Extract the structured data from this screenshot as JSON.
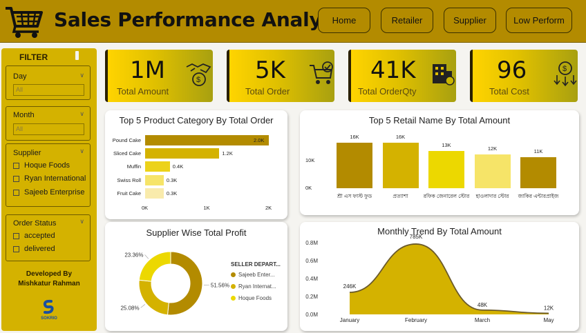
{
  "header": {
    "title": "Sales Performance Analysis",
    "nav": [
      "Home",
      "Retailer",
      "Supplier",
      "Low Perform"
    ]
  },
  "filter": {
    "title": "FILTER",
    "day": {
      "label": "Day",
      "value": "All"
    },
    "month": {
      "label": "Month",
      "value": "All"
    },
    "supplier": {
      "label": "Supplier",
      "options": [
        "Hoque Foods",
        "Ryan International",
        "Sajeeb Enterprise"
      ]
    },
    "order_status": {
      "label": "Order Status",
      "options": [
        "accepted",
        "delivered"
      ]
    },
    "developed_by": "Developed By",
    "developer": "Mishkatur Rahman",
    "brand": "SOKRIO"
  },
  "kpis": [
    {
      "value": "1M",
      "label": "Total Amount",
      "icon": "handshake-money-icon"
    },
    {
      "value": "5K",
      "label": "Total Order",
      "icon": "cart-check-icon"
    },
    {
      "value": "41K",
      "label": "Total OrderQty",
      "icon": "building-icon"
    },
    {
      "value": "96",
      "label": "Total Cost",
      "icon": "coin-down-icon"
    }
  ],
  "colors": {
    "header": "#b38b00",
    "sidebar": "#d4b200",
    "accent": "#ffd400"
  },
  "chart_data": [
    {
      "type": "bar",
      "orientation": "horizontal",
      "title": "Top 5 Product Category By Total Order",
      "categories": [
        "Pound Cake",
        "Sliced Cake",
        "Muffin",
        "Swiss Roll",
        "Fruit Cake"
      ],
      "values": [
        2000,
        1200,
        400,
        300,
        300
      ],
      "data_labels": [
        "2.0K",
        "1.2K",
        "0.4K",
        "0.3K",
        "0.3K"
      ],
      "x_ticks": [
        "0K",
        "1K",
        "2K"
      ],
      "xlim": [
        0,
        2000
      ],
      "colors": [
        "#b38b00",
        "#d4b200",
        "#ecd21a",
        "#f6e468",
        "#f9ebac"
      ]
    },
    {
      "type": "bar",
      "title": "Top 5 Retail Name By Total Amount",
      "categories": [
        "শ্রী এস ফাস্ট ফুড",
        "প্রত্যাশা",
        "রফিক জেনারেল স্টোর",
        "হাওলাদার স্টোর",
        "জাকির এন্টারপ্রাইজ"
      ],
      "values": [
        16000,
        16000,
        13000,
        12000,
        11000
      ],
      "data_labels": [
        "16K",
        "16K",
        "13K",
        "12K",
        "11K"
      ],
      "y_ticks": [
        "10K",
        "0K"
      ],
      "ylim": [
        0,
        16000
      ],
      "colors": [
        "#b38b00",
        "#d4b200",
        "#ecd800",
        "#f6e468",
        "#b38b00"
      ]
    },
    {
      "type": "pie",
      "title": "Supplier Wise Total Profit",
      "legend_title": "SELLER DEPART...",
      "slices": [
        {
          "name": "Sajeeb Enter...",
          "value": 51.56,
          "label": "51.56%",
          "color": "#b38b00"
        },
        {
          "name": "Ryan Internat...",
          "value": 25.08,
          "label": "25.08%",
          "color": "#d4b200"
        },
        {
          "name": "Hoque Foods",
          "value": 23.36,
          "label": "23.36%",
          "color": "#ecd800"
        }
      ]
    },
    {
      "type": "area",
      "title": "Monthly Trend By Total Amount",
      "x": [
        "January",
        "February",
        "March",
        "May"
      ],
      "values": [
        246000,
        785000,
        48000,
        12000
      ],
      "data_labels": [
        "246K",
        "785K",
        "48K",
        "12K"
      ],
      "y_ticks": [
        "0.8M",
        "0.6M",
        "0.4M",
        "0.2M",
        "0.0M"
      ],
      "ylim": [
        0,
        800000
      ],
      "color": "#d4b200"
    }
  ]
}
